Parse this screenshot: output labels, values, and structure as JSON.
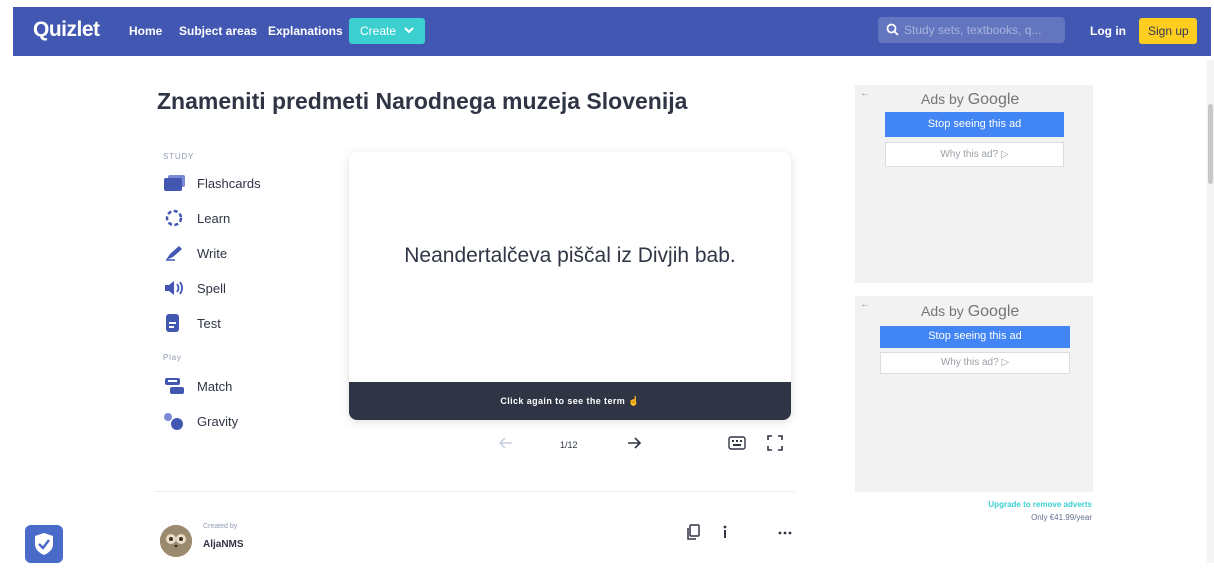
{
  "header": {
    "logo": "Quizlet",
    "nav": [
      "Home",
      "Subject areas",
      "Explanations"
    ],
    "create_label": "Create",
    "search_placeholder": "Study sets, textbooks, q...",
    "login_label": "Log in",
    "signup_label": "Sign up"
  },
  "set": {
    "title": "Znameniti predmeti Narodnega muzeja Slovenija"
  },
  "study": {
    "section_label": "STUDY",
    "modes": [
      "Flashcards",
      "Learn",
      "Write",
      "Spell",
      "Test"
    ],
    "play_label": "Play",
    "play_modes": [
      "Match",
      "Gravity"
    ]
  },
  "flashcard": {
    "text": "Neandertalčeva piščal iz Divjih bab.",
    "footer": "Click again to see the term",
    "progress": "1/12"
  },
  "creator": {
    "created_by_label": "Created by",
    "name": "AljaNMS"
  },
  "ads": [
    {
      "ads_by": "Ads by",
      "brand": "Google",
      "stop_label": "Stop seeing this ad",
      "why_label": "Why this ad? ▷"
    },
    {
      "ads_by": "Ads by",
      "brand": "Google",
      "stop_label": "Stop seeing this ad",
      "why_label": "Why this ad? ▷"
    }
  ],
  "upgrade": {
    "link": "Upgrade to remove adverts",
    "price": "Only €41.99/year"
  },
  "colors": {
    "brand": "#4257b2",
    "accent": "#3ccfcf",
    "signup": "#ffcd1f",
    "dark": "#303545"
  }
}
